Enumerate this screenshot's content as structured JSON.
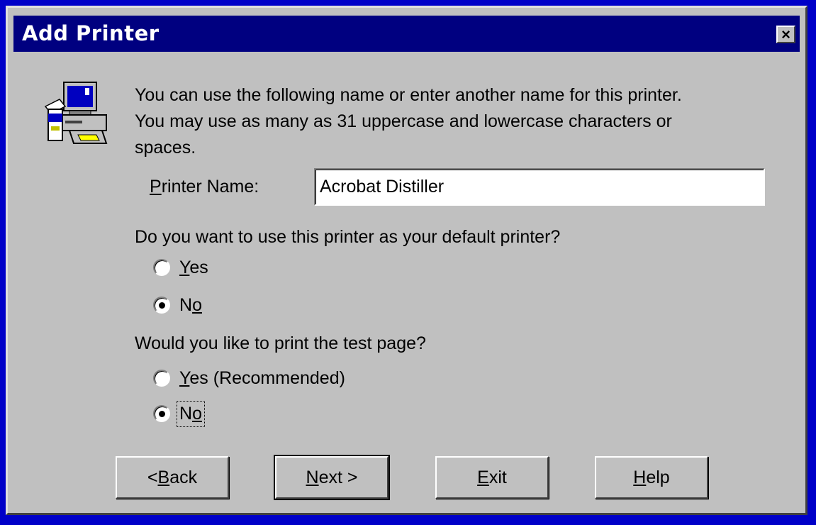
{
  "window": {
    "title": "Add Printer",
    "close_glyph": "×"
  },
  "icon": {
    "name": "printer-wizard-icon"
  },
  "intro": {
    "line1": "You can use the following name or enter another name for this printer.",
    "line2": "You may use as many as 31 uppercase and lowercase characters or",
    "line3": "spaces."
  },
  "printer_name": {
    "label_hotkey": "P",
    "label_rest": "rinter Name:",
    "value": "Acrobat Distiller"
  },
  "default_question": {
    "text": "Do you want to use this printer as your default printer?",
    "options": [
      {
        "hotkey": "Y",
        "rest": "es",
        "selected": false
      },
      {
        "pre": "N",
        "hotkey": "o",
        "selected": true
      }
    ]
  },
  "test_question": {
    "text": "Would you like to print the test page?",
    "options": [
      {
        "hotkey": "Y",
        "rest": "es (Recommended)",
        "selected": false
      },
      {
        "pre": "N",
        "hotkey": "o",
        "selected": true
      }
    ]
  },
  "buttons": {
    "back": {
      "pre": "< ",
      "hotkey": "B",
      "rest": "ack"
    },
    "next": {
      "hotkey": "N",
      "rest": "ext >"
    },
    "exit": {
      "hotkey": "E",
      "rest": "xit"
    },
    "help": {
      "hotkey": "H",
      "rest": "elp"
    }
  },
  "colors": {
    "titlebar": "#000080",
    "face": "#c0c0c0",
    "desktop": "#0000c8"
  }
}
